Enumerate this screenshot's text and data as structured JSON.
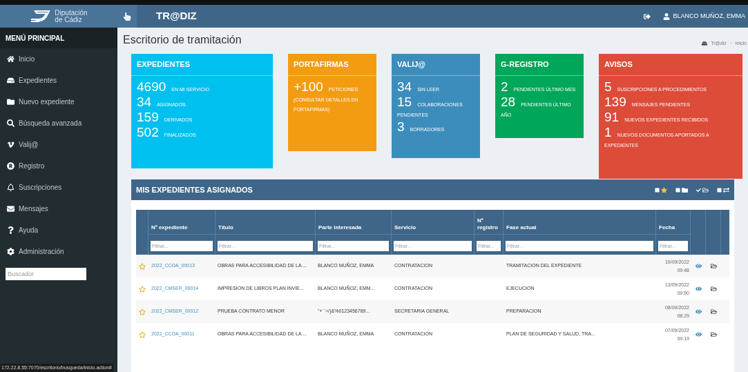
{
  "header": {
    "logo_text": [
      "Diputación",
      "de Cádiz"
    ],
    "app_title": "TR@DIZ",
    "user": "BLANCO MUÑOZ, EMMA"
  },
  "sidebar": {
    "heading": "MENÚ PRINCIPAL",
    "items": [
      {
        "label": "Inicio"
      },
      {
        "label": "Expedientes"
      },
      {
        "label": "Nuevo expediente"
      },
      {
        "label": "Búsqueda avanzada"
      },
      {
        "label": "Valij@"
      },
      {
        "label": "Registro"
      },
      {
        "label": "Suscripciones"
      },
      {
        "label": "Mensajes"
      },
      {
        "label": "Ayuda"
      },
      {
        "label": "Administración"
      }
    ],
    "search": {
      "placeholder": "Buscador"
    }
  },
  "page_title": "Escritorio de tramitación",
  "breadcrumb": [
    "Tr@diz",
    "Inicio"
  ],
  "cards": [
    {
      "title": "EXPEDIENTES",
      "color": "#00c0ef",
      "stats": [
        {
          "value": "4690",
          "label": "EN MI SERVICIO"
        },
        {
          "value": "34",
          "label": "ASIGNADOS"
        },
        {
          "value": "159",
          "label": "DERIVADOS"
        },
        {
          "value": "502",
          "label": "FINALIZADOS"
        }
      ]
    },
    {
      "title": "PORTAFIRMAS",
      "color": "#f39c12",
      "stats": [
        {
          "value": "+100",
          "label": "PETICIONES (CONSULTAR DETALLES EN PORTAFIRMAS)"
        }
      ]
    },
    {
      "title": "VALIJ@",
      "color": "#3c8dbc",
      "stats": [
        {
          "value": "34",
          "label": "SIN LEER"
        },
        {
          "value": "15",
          "label": "COLABORACIONES PENDIENTES"
        },
        {
          "value": "3",
          "label": "BORRADORES"
        }
      ]
    },
    {
      "title": "G-REGISTRO",
      "color": "#00a65a",
      "stats": [
        {
          "value": "2",
          "label": "PENDIENTES ÚLTIMO MES"
        },
        {
          "value": "28",
          "label": "PENDIENTES ÚLTIMO AÑO"
        }
      ]
    },
    {
      "title": "AVISOS",
      "color": "#dd4b39",
      "stats": [
        {
          "value": "5",
          "label": "SUSCRIPCIONES A PROCEDIMIENTOS"
        },
        {
          "value": "139",
          "label": "MENSAJES PENDIENTES"
        },
        {
          "value": "91",
          "label": "NUEVOS EXPEDIENTES RECIBIDOS"
        },
        {
          "value": "1",
          "label": "NUEVOS DOCUMENTOS APORTADOS A EXPEDIENTES"
        }
      ]
    }
  ],
  "panel": {
    "title": "MIS EXPEDIENTES ASIGNADOS",
    "toggles": [
      {
        "checked": false
      },
      {
        "checked": false
      },
      {
        "checked": true
      },
      {
        "checked": false
      }
    ],
    "columns": [
      {
        "label": "Nº expediente",
        "placeholder": "Filtrar..."
      },
      {
        "label": "Título",
        "placeholder": "Filtrar..."
      },
      {
        "label": "Parte interesada",
        "placeholder": "Filtrar..."
      },
      {
        "label": "Servicio",
        "placeholder": "Filtrar..."
      },
      {
        "label": "Nº registro",
        "placeholder": "Filtrar..."
      },
      {
        "label": "Fase actual",
        "placeholder": "Filtrar..."
      },
      {
        "label": "Fecha",
        "placeholder": "Filtrar..."
      }
    ],
    "rows": [
      {
        "starred": false,
        "expediente": "2022_CCOA_00013",
        "titulo": "OBRAS PARA ACCESIBILIDAD DE LA ...",
        "parte": "BLANCO MUÑOZ, EMMA",
        "servicio": "CONTRATACION",
        "fase": "TRAMITACION DEL EXPEDIENTE",
        "fecha": "19/09/2022",
        "hora": "09:48"
      },
      {
        "starred": false,
        "expediente": "2022_CMSER_00014",
        "titulo": "IMPRESION DE LIBROS PLAN INVIE...",
        "parte": "BLANCO MUÑOZ, EMM...",
        "servicio": "CONTRATACION",
        "fase": "EJECUCION",
        "fecha": "13/09/2022",
        "hora": "09:50"
      },
      {
        "starred": false,
        "expediente": "2022_CMSER_00012",
        "titulo": "PRUEBA CONTRATO MENOR",
        "parte": "\"+`´=/)&%0123456789...",
        "servicio": "SECRETARIA GENERAL",
        "fase": "PREPARACION",
        "fecha": "08/09/2022",
        "hora": "08:29"
      },
      {
        "starred": false,
        "expediente": "2022_CCOA_00011",
        "titulo": "OBRAS PARA ACCESIBILIDAD DE LA ...",
        "parte": "BLANCO MUÑOZ, EMMA",
        "servicio": "CONTRATACION",
        "fase": "PLAN DE SEGURIDAD Y SALUD, TRA...",
        "fecha": "07/09/2022",
        "hora": "09:19"
      }
    ]
  },
  "status_url": "172.22.8.55:7070/escritorio/busqueda/inicio.action#"
}
